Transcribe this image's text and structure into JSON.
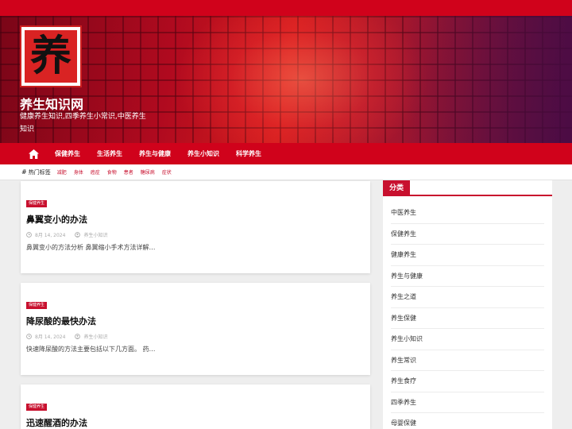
{
  "header": {
    "logo_char": "养",
    "site_title": "养生知识网",
    "site_description": "健康养生知识,四季养生小常识,中医养生知识"
  },
  "nav": {
    "home_icon": "home-icon",
    "items": [
      "保健养生",
      "生活养生",
      "养生与健康",
      "养生小知识",
      "科学养生"
    ]
  },
  "tags": {
    "label": "热门标签",
    "items": [
      "减肥",
      "身体",
      "癌症",
      "食物",
      "患者",
      "糖尿病",
      "症状"
    ]
  },
  "posts": [
    {
      "category": "保健养生",
      "title": "鼻翼变小的办法",
      "date": "8月 14, 2024",
      "author": "养生小知识",
      "excerpt": "鼻翼变小的方法分析 鼻翼缩小手术方法详解…"
    },
    {
      "category": "保健养生",
      "title": "降尿酸的最快办法",
      "date": "8月 14, 2024",
      "author": "养生小知识",
      "excerpt": "快速降尿酸的方法主要包括以下几方面。 药…"
    },
    {
      "category": "保健养生",
      "title": "迅速醒酒的办法",
      "date": "",
      "author": "",
      "excerpt": ""
    }
  ],
  "sidebar": {
    "heading": "分类",
    "items": [
      "中医养生",
      "保健养生",
      "健康养生",
      "养生与健康",
      "养生之道",
      "养生保健",
      "养生小知识",
      "养生常识",
      "养生食疗",
      "四季养生",
      "母婴保健"
    ]
  },
  "colors": {
    "brand_red": "#d0021b",
    "accent_red": "#c8102e"
  }
}
